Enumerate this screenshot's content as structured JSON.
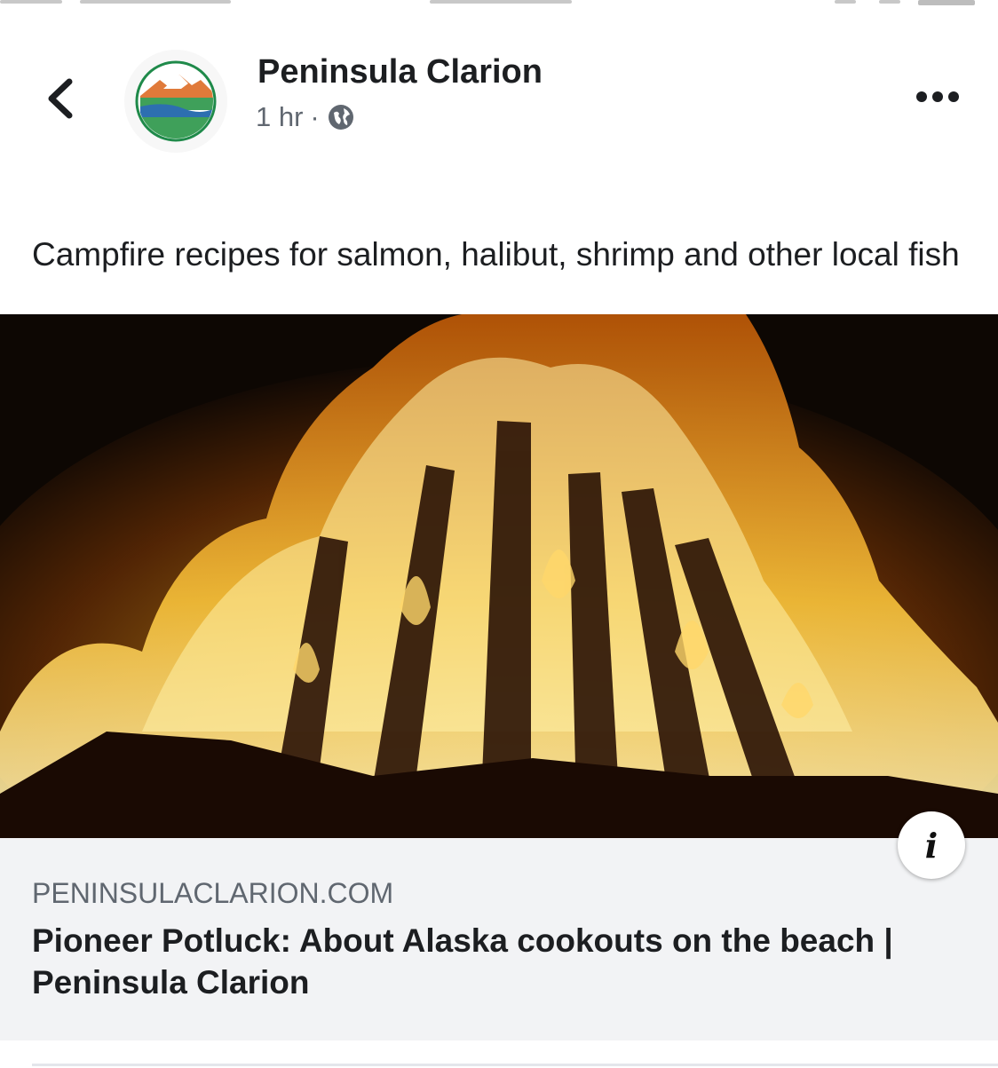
{
  "post": {
    "page_name": "Peninsula Clarion",
    "time": "1 hr",
    "separator": "·",
    "privacy_icon": "globe-icon",
    "caption": "Campfire recipes for salmon, halibut, shrimp and other local fish"
  },
  "link_preview": {
    "domain": "PENINSULACLARION.COM",
    "title": "Pioneer Potluck: About Alaska cookouts on the beach | Peninsula Clarion",
    "info_icon": "i"
  },
  "icons": {
    "back": "chevron-left-icon",
    "more": "more-horizontal-icon",
    "info": "info-icon"
  },
  "colors": {
    "text_primary": "#1c1e21",
    "text_secondary": "#606770",
    "card_background": "#f2f3f5"
  }
}
